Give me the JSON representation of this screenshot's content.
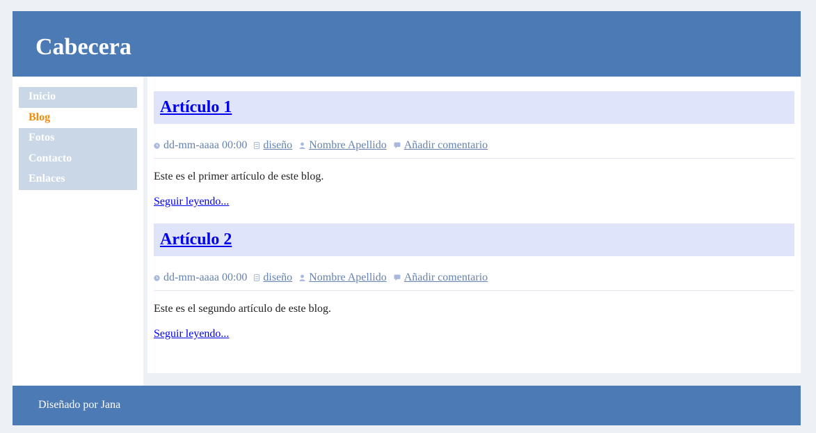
{
  "header": {
    "title": "Cabecera"
  },
  "sidebar": {
    "items": [
      {
        "label": "Inicio"
      },
      {
        "label": "Blog"
      },
      {
        "label": "Fotos"
      },
      {
        "label": "Contacto"
      },
      {
        "label": "Enlaces"
      }
    ]
  },
  "articles": [
    {
      "title": "Artículo 1",
      "date": "dd-mm-aaaa 00:00",
      "category": "diseño",
      "author": "Nombre Apellido",
      "comment_link": "Añadir comentario",
      "excerpt": "Este es el primer artículo de este blog.",
      "read_more": "Seguir leyendo..."
    },
    {
      "title": "Artículo 2",
      "date": "dd-mm-aaaa 00:00",
      "category": "diseño",
      "author": "Nombre Apellido",
      "comment_link": "Añadir comentario",
      "excerpt": "Este es el segundo artículo de este blog.",
      "read_more": "Seguir leyendo..."
    }
  ],
  "footer": {
    "text": "Diseñado por Jana"
  },
  "colors": {
    "page_background": "#edf1f5",
    "header_background": "#4c7ab5",
    "nav_item_background": "#c9d7e7",
    "nav_active_text": "#f28c0f",
    "article_title_background": "#dfe4fb",
    "meta_text": "#6683ae",
    "link": "#0000ee"
  },
  "icons": {
    "date": "clock-icon",
    "category": "folder-icon",
    "author": "user-icon",
    "comment": "comment-icon"
  }
}
